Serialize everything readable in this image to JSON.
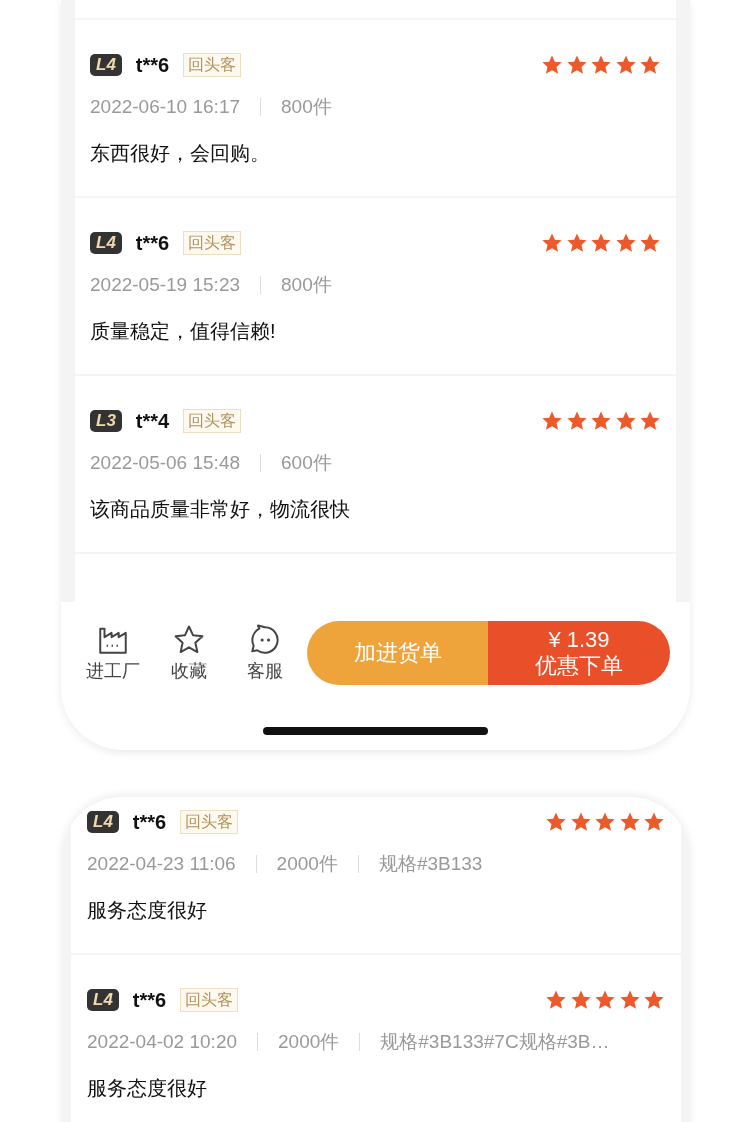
{
  "phones": [
    {
      "reviews": [
        {
          "level": "L4",
          "user": "t**6",
          "tag": "回头客",
          "stars": 5,
          "date": "2022-06-10 16:17",
          "quantity": "800件",
          "text": "东西很好，会回购。"
        },
        {
          "level": "L4",
          "user": "t**6",
          "tag": "回头客",
          "stars": 5,
          "date": "2022-05-19 15:23",
          "quantity": "800件",
          "text": "质量稳定，值得信赖!"
        },
        {
          "level": "L3",
          "user": "t**4",
          "tag": "回头客",
          "stars": 5,
          "date": "2022-05-06 15:48",
          "quantity": "600件",
          "text": "该商品质量非常好，物流很快"
        }
      ],
      "toolbar": {
        "actions": [
          {
            "label": "进工厂"
          },
          {
            "label": "收藏"
          },
          {
            "label": "客服"
          }
        ],
        "cart_button": "加进货单",
        "order_button": {
          "price": "¥ 1.39",
          "label": "优惠下单"
        }
      }
    },
    {
      "reviews": [
        {
          "level": "L4",
          "user": "t**6",
          "tag": "回头客",
          "stars": 5,
          "date": "2022-04-23 11:06",
          "quantity": "2000件",
          "spec": "规格#3B133",
          "text": "服务态度很好"
        },
        {
          "level": "L4",
          "user": "t**6",
          "tag": "回头客",
          "stars": 5,
          "date": "2022-04-02 10:20",
          "quantity": "2000件",
          "spec": "规格#3B133#7C规格#3B…",
          "text": "服务态度很好"
        }
      ]
    }
  ]
}
